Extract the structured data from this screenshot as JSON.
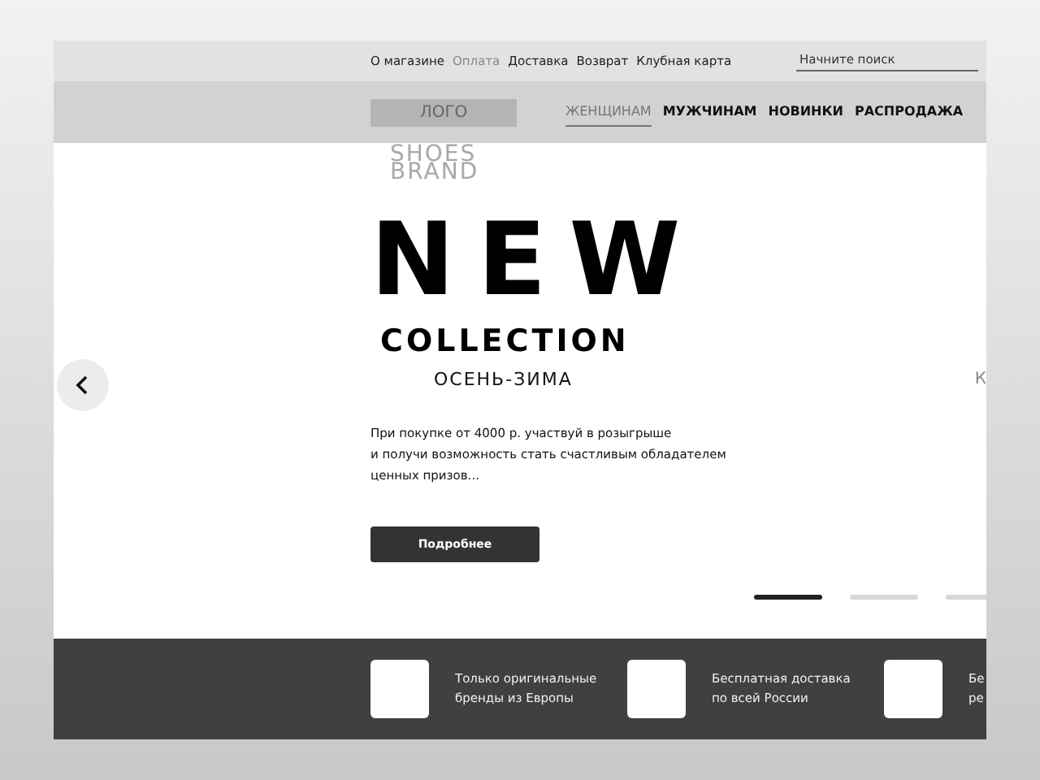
{
  "top_links": [
    {
      "label": "О магазине",
      "selected": false
    },
    {
      "label": "Оплата",
      "selected": true
    },
    {
      "label": "Доставка",
      "selected": false
    },
    {
      "label": "Возврат",
      "selected": false
    },
    {
      "label": "Клубная карта",
      "selected": false
    }
  ],
  "search": {
    "placeholder": "Начните поиск"
  },
  "logo": "ЛОГО",
  "nav": [
    {
      "label": "ЖЕНЩИНАМ",
      "selected": true
    },
    {
      "label": "МУЖЧИНАМ",
      "selected": false
    },
    {
      "label": "НОВИНКИ",
      "selected": false
    },
    {
      "label": "РАСПРОДАЖА",
      "selected": false
    }
  ],
  "hero": {
    "brand": [
      "SHOES",
      "BRAND"
    ],
    "headline": "NEW",
    "subheadline": "COLLECTION",
    "season": "ОСЕНЬ-ЗИМА",
    "text": [
      "При покупке от 4000 р. участвуй в розыгрыше",
      "и получи возможность стать счастливым обладателем",
      "ценных призов..."
    ],
    "button": "Подробнее",
    "next_slide_peek": "К"
  },
  "slides": [
    {
      "selected": true
    },
    {
      "selected": false
    },
    {
      "selected": false
    }
  ],
  "features": [
    {
      "lines": [
        "Только оригинальные",
        "бренды из Европы"
      ]
    },
    {
      "lines": [
        "Бесплатная доставка",
        "по всей России"
      ]
    },
    {
      "lines": [
        "Бе",
        "ре"
      ]
    }
  ]
}
